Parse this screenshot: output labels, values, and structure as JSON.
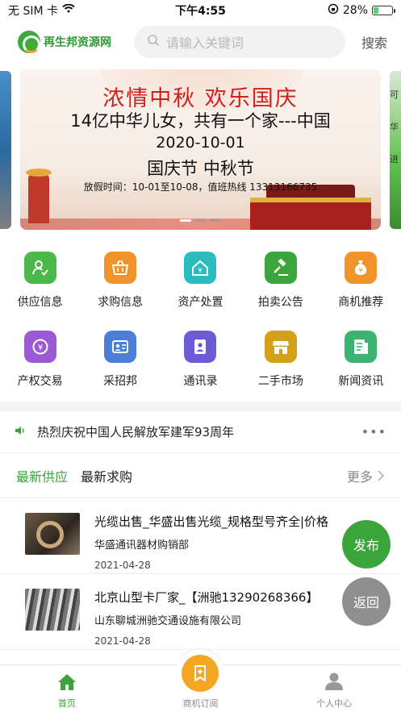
{
  "status_bar": {
    "carrier": "无 SIM 卡",
    "time": "下午4:55",
    "battery_percent": "28%",
    "battery_level": 0.28
  },
  "header": {
    "logo_text": "再生邦资源网",
    "search_placeholder": "请输入关键词",
    "search_button": "搜索"
  },
  "banner": {
    "title": "浓情中秋   欢乐国庆",
    "line2": "14亿中华儿女，共有一个家---中国",
    "date": "2020-10-01",
    "line4": "国庆节  中秋节",
    "line5": "放假时间：10-01至10-08，值班热线 13313166735",
    "side_right_text": "可\n华\n进",
    "active_dot": 0,
    "dot_count": 3
  },
  "menu": {
    "row1": [
      {
        "label": "供应信息",
        "icon": "supply-icon",
        "color": "#4cb84a"
      },
      {
        "label": "求购信息",
        "icon": "basket-icon",
        "color": "#f0932b"
      },
      {
        "label": "资产处置",
        "icon": "house-icon",
        "color": "#2bbcc0"
      },
      {
        "label": "拍卖公告",
        "icon": "gavel-icon",
        "color": "#3aa53a"
      },
      {
        "label": "商机推荐",
        "icon": "moneybag-icon",
        "color": "#f0932b"
      }
    ],
    "row2": [
      {
        "label": "产权交易",
        "icon": "exchange-icon",
        "color": "#9b59d6"
      },
      {
        "label": "采招邦",
        "icon": "idcard-icon",
        "color": "#4a7ed8"
      },
      {
        "label": "通讯录",
        "icon": "contacts-icon",
        "color": "#6b5bd6"
      },
      {
        "label": "二手市场",
        "icon": "shop-icon",
        "color": "#d4a017"
      },
      {
        "label": "新闻资讯",
        "icon": "news-icon",
        "color": "#3cb371"
      }
    ]
  },
  "notice": {
    "text": "热烈庆祝中国人民解放军建军93周年",
    "more": "•••"
  },
  "tabs": {
    "items": [
      "最新供应",
      "最新求购"
    ],
    "active": 0,
    "more": "更多"
  },
  "list": [
    {
      "title": "光缆出售_华盛出售光缆_规格型号齐全|价格",
      "company": "华盛通讯器材购销部",
      "date": "2021-04-28"
    },
    {
      "title": "北京山型卡厂家_【洲驰13290268366】",
      "company": "山东聊城洲驰交通设施有限公司",
      "date": "2021-04-28"
    }
  ],
  "floating": {
    "publish": "发布",
    "back": "返回"
  },
  "tabbar": {
    "items": [
      "首页",
      "商机订阅",
      "个人中心"
    ],
    "active": 0
  },
  "colors": {
    "accent": "#3aa53a",
    "orange": "#f5a623"
  }
}
